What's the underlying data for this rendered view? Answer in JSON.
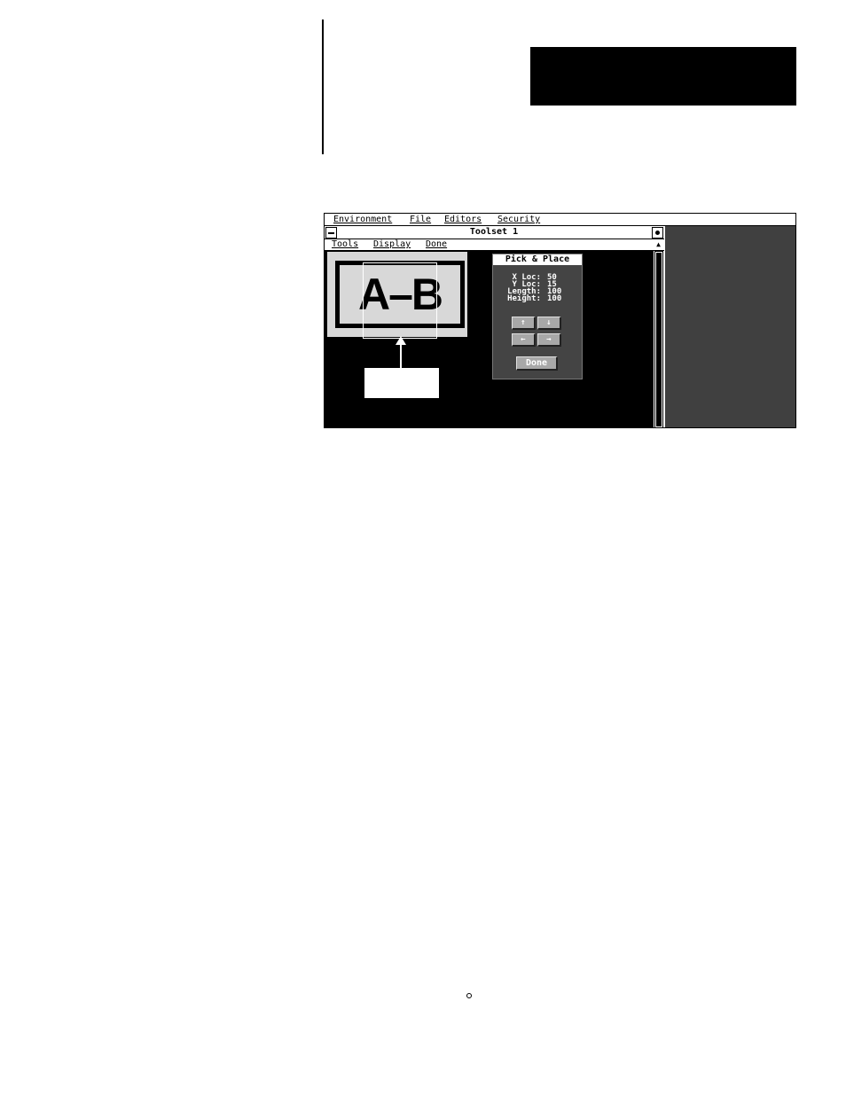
{
  "app_menubar": {
    "items": [
      "Environment",
      "File",
      "Editors",
      "Security"
    ]
  },
  "toolset_window": {
    "title": "Toolset 1",
    "menu_items": [
      "Tools",
      "Display",
      "Done"
    ],
    "icons": {
      "system_menu": "minus-icon",
      "maximize": "dot-icon",
      "scroll_up": "triangle-up-icon"
    }
  },
  "camera_image": {
    "label_text": "A–B"
  },
  "pick_place_dialog": {
    "title": "Pick & Place",
    "fields": [
      {
        "label": "X Loc:",
        "value": "50"
      },
      {
        "label": "Y Loc:",
        "value": "15"
      },
      {
        "label": "Length:",
        "value": "100"
      },
      {
        "label": "Height:",
        "value": "100"
      }
    ],
    "buttons": {
      "up": "↑",
      "down": "↓",
      "left": "←",
      "right": "→",
      "done": "Done"
    }
  },
  "colors": {
    "screen_bg": "#000000",
    "dialog_bg": "#444444",
    "right_area": "#404040",
    "image_bg": "#d8d8d8"
  }
}
